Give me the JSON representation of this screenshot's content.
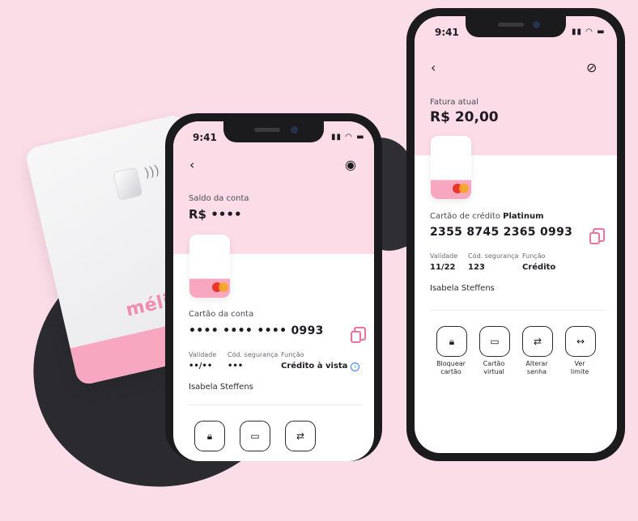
{
  "brand_logo": "méliuz",
  "phone1": {
    "time": "9:41",
    "balance_label": "Saldo da conta",
    "balance_value": "R$ ••••",
    "card_section_label": "Cartão da conta",
    "card_number": "•••• •••• •••• 0993",
    "fields": [
      {
        "label": "Validade",
        "value": "••/••"
      },
      {
        "label": "Cód. segurança",
        "value": "•••"
      },
      {
        "label": "Função",
        "value": "Crédito à vista"
      }
    ],
    "holder": "Isabela Steffens",
    "actions": [
      "lock-icon",
      "card-icon",
      "swap-icon"
    ]
  },
  "phone2": {
    "time": "9:41",
    "invoice_label": "Fatura atual",
    "invoice_value": "R$ 20,00",
    "card_section_label": "Cartão de crédito",
    "card_tier": "Platinum",
    "card_number": "2355 8745 2365 0993",
    "fields": [
      {
        "label": "Validade",
        "value": "11/22"
      },
      {
        "label": "Cód. segurança",
        "value": "123"
      },
      {
        "label": "Função",
        "value": "Crédito"
      }
    ],
    "holder": "Isabela Steffens",
    "actions": [
      {
        "icon": "lock-icon",
        "label1": "Bloquear",
        "label2": "cartão"
      },
      {
        "icon": "card-icon",
        "label1": "Cartão",
        "label2": "virtual"
      },
      {
        "icon": "swap-icon",
        "label1": "Alterar",
        "label2": "senha"
      },
      {
        "icon": "arrows-icon",
        "label1": "Ver",
        "label2": "limite"
      }
    ]
  },
  "colors": {
    "pink_bg": "#fbdde7",
    "accent": "#f3719c",
    "card_band": "#f7a7c0",
    "dark": "#1b1b1d"
  }
}
